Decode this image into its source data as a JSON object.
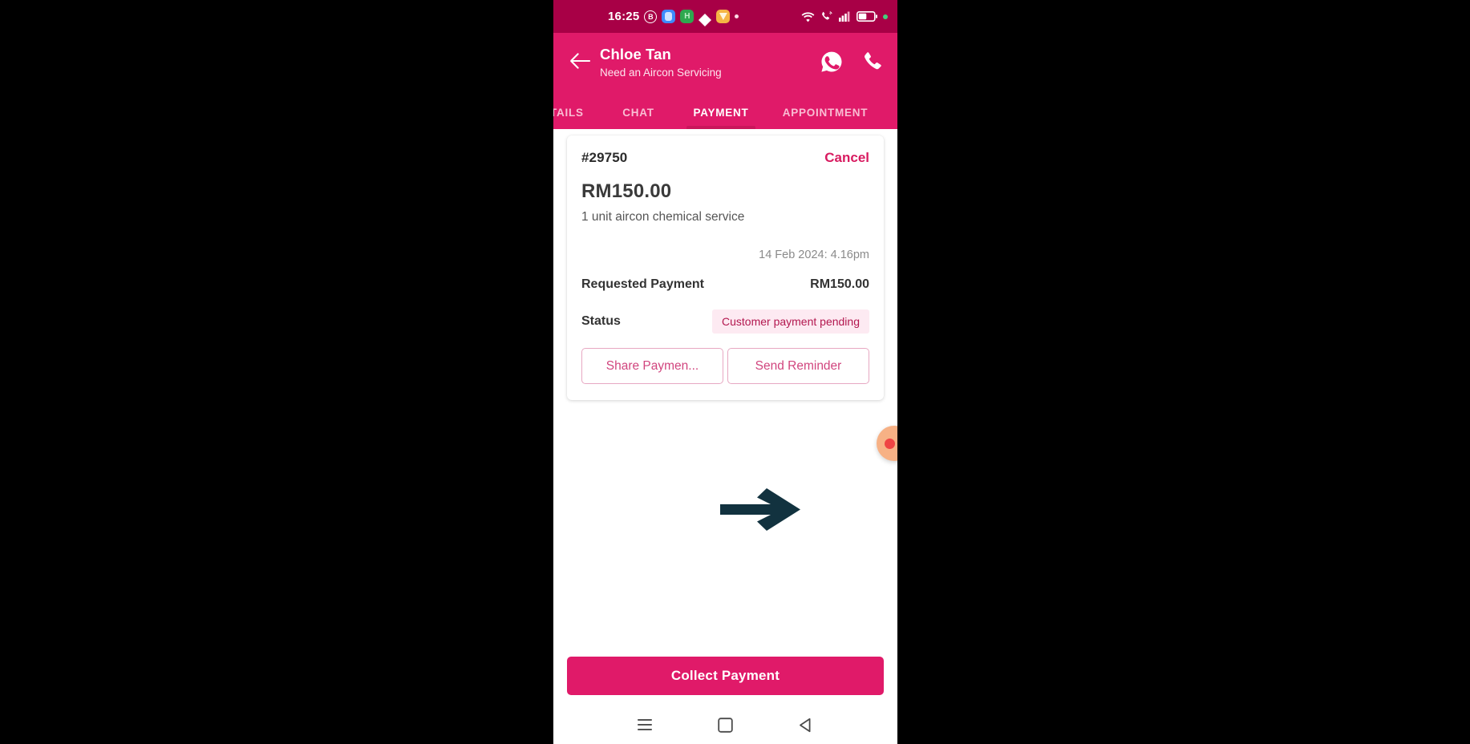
{
  "status_bar": {
    "clock": "16:25",
    "left_icons": [
      "badge-b-icon",
      "app-blue-icon",
      "app-green-icon",
      "diamond-icon",
      "app-amber-icon",
      "dot-icon"
    ],
    "right_icons": [
      "wifi-icon",
      "call-signal-icon",
      "cellular-signal-icon",
      "battery-icon",
      "dot-green-icon"
    ],
    "bg_color": "#a80046"
  },
  "app_bar": {
    "back_icon": "arrow-left-icon",
    "contact_name": "Chloe Tan",
    "subtitle": "Need an Aircon Servicing",
    "whatsapp_icon": "whatsapp-icon",
    "call_icon": "phone-icon",
    "bg_color": "#e01a69"
  },
  "tabs": {
    "items": [
      {
        "label": "ETAILS",
        "active": false
      },
      {
        "label": "CHAT",
        "active": false
      },
      {
        "label": "PAYMENT",
        "active": true
      },
      {
        "label": "APPOINTMENT",
        "active": false
      }
    ],
    "active_indicator_color": "#c9165b",
    "inactive_color": "#f9bdd3"
  },
  "payment_card": {
    "order_id": "#29750",
    "cancel_label": "Cancel",
    "amount": "RM150.00",
    "description": "1 unit aircon chemical service",
    "timestamp": "14 Feb 2024: 4.16pm",
    "requested_payment_label": "Requested Payment",
    "requested_payment_value": "RM150.00",
    "status_label": "Status",
    "status_badge": "Customer payment pending",
    "status_badge_bg": "#fdeaf2",
    "status_badge_color": "#b3174f",
    "share_button": "Share Paymen...",
    "reminder_button": "Send Reminder",
    "button_border_color": "#e7a8c2",
    "button_text_color": "#d1457e"
  },
  "fab": {
    "name": "floating-action-button",
    "color": "#f7b185",
    "dot_color": "#ef4444"
  },
  "cta": {
    "label": "Collect Payment",
    "bg_color": "#e01a69"
  },
  "nav_bar": {
    "items": [
      "recents-icon",
      "home-icon",
      "back-icon"
    ]
  },
  "annotation": {
    "type": "arrow",
    "color": "#12323f",
    "points_to": "Send Reminder"
  }
}
